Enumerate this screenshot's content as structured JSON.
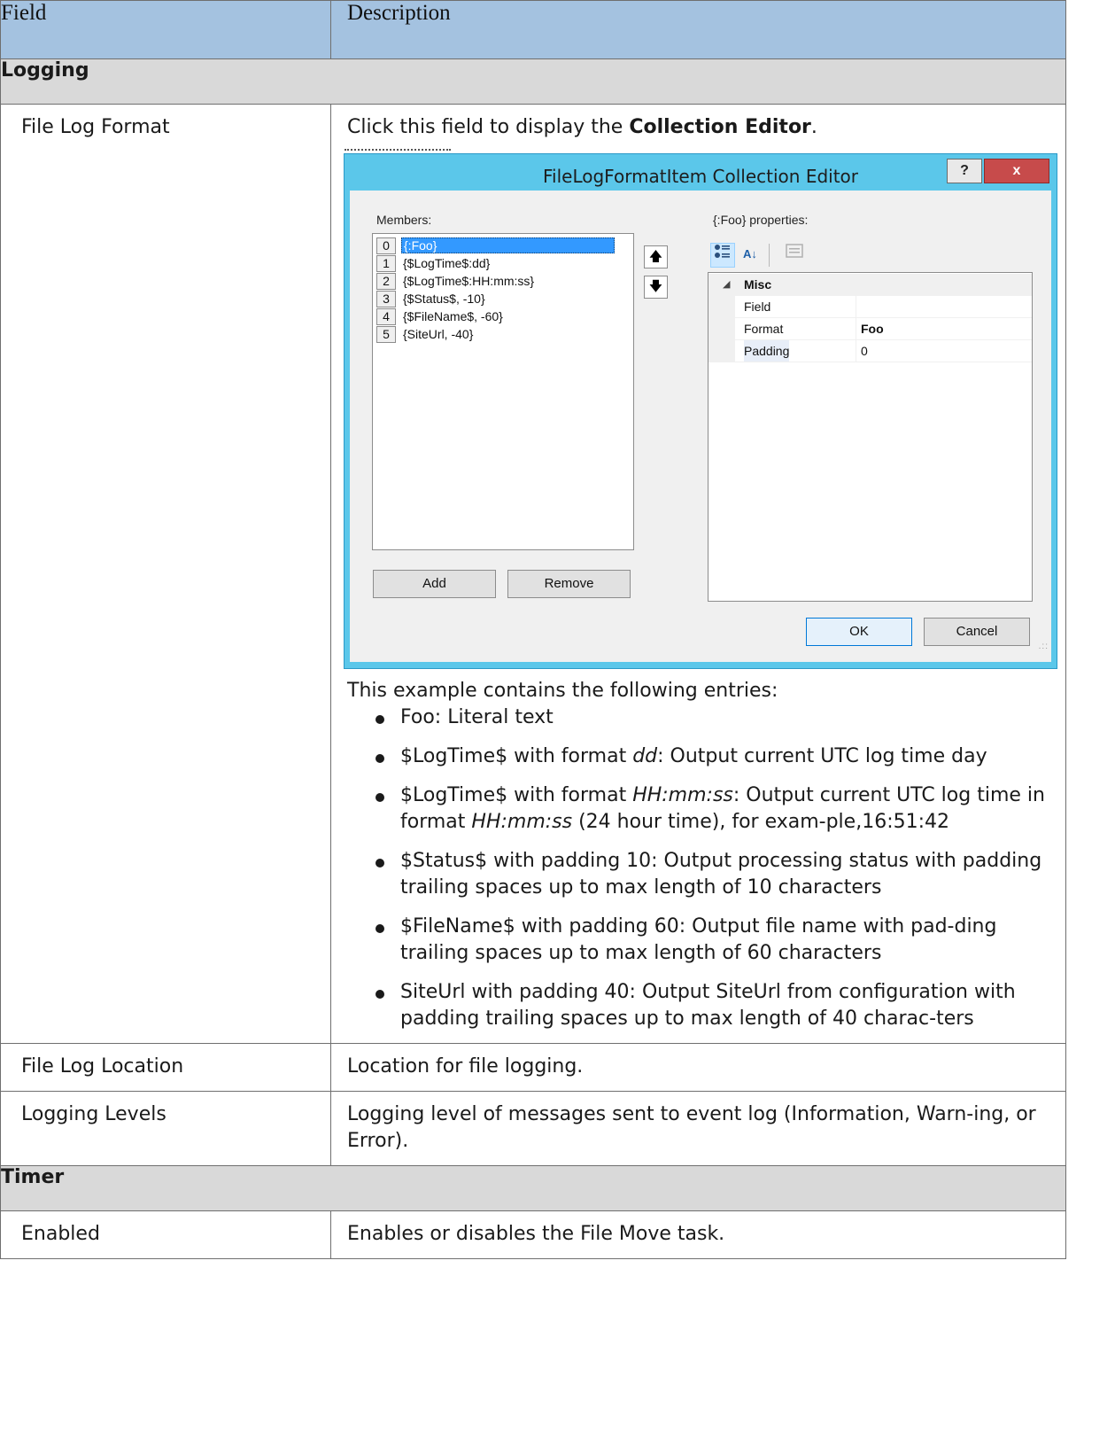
{
  "table": {
    "header": {
      "field": "Field",
      "description": "Description"
    },
    "sections": {
      "logging": "Logging",
      "timer": "Timer"
    },
    "rows": {
      "file_log_format": {
        "field": "File Log Format",
        "intro_prefix": "Click this field to display the ",
        "intro_bold": "Collection Editor",
        "intro_suffix": ".",
        "example_intro": "This example contains the following entries:",
        "entries": [
          {
            "a": "Foo: Literal text"
          },
          {
            "a": "$LogTime$  with format ",
            "i": "dd",
            "b": ": Output current UTC log time day"
          },
          {
            "a": "$LogTime$ with format ",
            "i": "HH:mm:ss",
            "b": ": Output current UTC log time in format ",
            "i2": "HH:mm:ss",
            "c": " (24 hour time), for exam-ple,16:51:42"
          },
          {
            "a": "$Status$ with padding 10: Output processing status with padding trailing spaces up to max length of 10 characters"
          },
          {
            "a": "$FileName$ with padding 60: Output file name with pad-ding trailing spaces up to max length of 60 characters"
          },
          {
            "a": "SiteUrl with padding 40: Output SiteUrl from configuration with padding trailing spaces up to max length of 40 charac-ters"
          }
        ]
      },
      "file_log_location": {
        "field": "File Log Location",
        "description": "Location for file logging."
      },
      "logging_levels": {
        "field": "Logging Levels",
        "description": "Logging level of messages sent to event log (Information, Warn-ing, or Error)."
      },
      "enabled": {
        "field": "Enabled",
        "description": "Enables or disables the File Move task."
      }
    }
  },
  "dialog": {
    "title": "FileLogFormatItem Collection Editor",
    "help_label": "?",
    "close_label": "x",
    "members_label": "Members:",
    "members": [
      {
        "index": "0",
        "text": "{:Foo}",
        "selected": true
      },
      {
        "index": "1",
        "text": "{$LogTime$:dd}"
      },
      {
        "index": "2",
        "text": "{$LogTime$:HH:mm:ss}"
      },
      {
        "index": "3",
        "text": "{$Status$, -10}"
      },
      {
        "index": "4",
        "text": "{$FileName$, -60}"
      },
      {
        "index": "5",
        "text": "{SiteUrl, -40}"
      }
    ],
    "move_up_glyph": "🡅",
    "move_down_glyph": "🡇",
    "add_label": "Add",
    "remove_label": "Remove",
    "properties_label": "{:Foo} properties:",
    "categorized_icon": "categorized-icon",
    "alphabetical_icon": "alphabetical-icon",
    "property_pages_icon": "property-pages-icon",
    "az_glyph": "A↓",
    "category": "Misc",
    "properties": [
      {
        "name": "Field",
        "value": ""
      },
      {
        "name": "Format",
        "value": "Foo",
        "bold": true
      },
      {
        "name": "Padding",
        "value": "0"
      }
    ],
    "ok_label": "OK",
    "cancel_label": "Cancel"
  },
  "colors": {
    "header_bg": "#a4c2e0",
    "section_bg": "#d9d9d9",
    "dialog_frame": "#5bc7ea",
    "close_button": "#c74b4b",
    "selection": "#3399ff"
  }
}
